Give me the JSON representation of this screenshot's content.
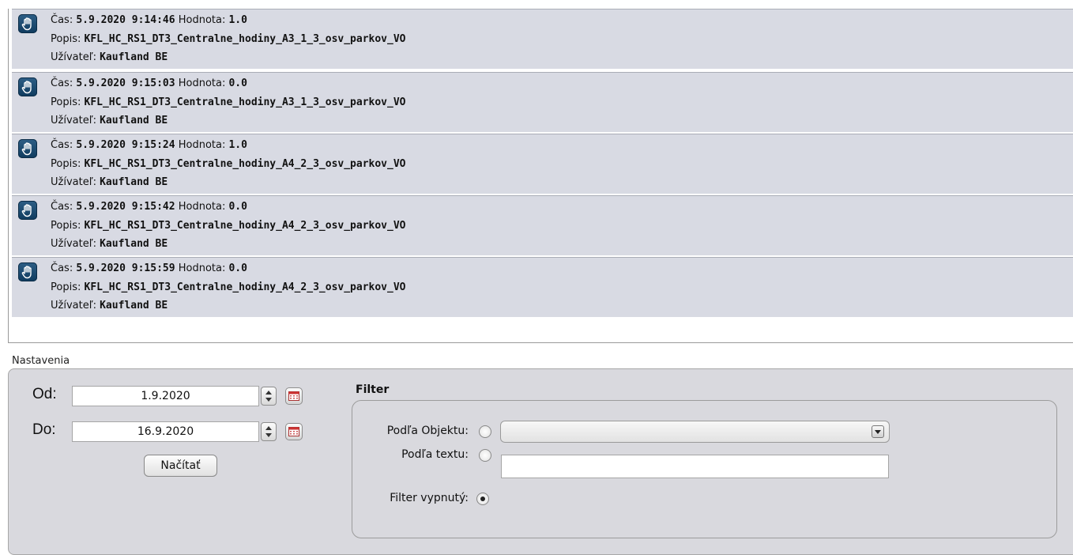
{
  "log": {
    "labels": {
      "cas": "Čas:",
      "hodnota": "Hodnota:",
      "popis": "Popis:",
      "uzivatel": "Užívateľ:"
    },
    "entries": [
      {
        "time": "5.9.2020 9:14:46",
        "value": "1.0",
        "description": "KFL_HC_RS1_DT3_Centralne_hodiny_A3_1_3_osv_parkov_VO",
        "user": "Kaufland BE"
      },
      {
        "time": "5.9.2020 9:15:03",
        "value": "0.0",
        "description": "KFL_HC_RS1_DT3_Centralne_hodiny_A3_1_3_osv_parkov_VO",
        "user": "Kaufland BE"
      },
      {
        "time": "5.9.2020 9:15:24",
        "value": "1.0",
        "description": "KFL_HC_RS1_DT3_Centralne_hodiny_A4_2_3_osv_parkov_VO",
        "user": "Kaufland BE"
      },
      {
        "time": "5.9.2020 9:15:42",
        "value": "0.0",
        "description": "KFL_HC_RS1_DT3_Centralne_hodiny_A4_2_3_osv_parkov_VO",
        "user": "Kaufland BE"
      },
      {
        "time": "5.9.2020 9:15:59",
        "value": "0.0",
        "description": "KFL_HC_RS1_DT3_Centralne_hodiny_A4_2_3_osv_parkov_VO",
        "user": "Kaufland BE"
      }
    ],
    "icon": "hand-stop-icon"
  },
  "settings": {
    "title": "Nastavenia",
    "from_label": "Od:",
    "from_date": "1.9.2020",
    "to_label": "Do:",
    "to_date": "16.9.2020",
    "load_button": "Načítať"
  },
  "filter": {
    "title": "Filter",
    "by_object_label": "Podľa Objektu:",
    "by_object_selected": false,
    "object_select_value": "",
    "by_text_label": "Podľa textu:",
    "by_text_selected": false,
    "text_value": "",
    "off_label": "Filter vypnutý:",
    "off_selected": true
  },
  "colors": {
    "entry_bg": "#d8dae3",
    "panel_bg": "#d9d9de",
    "icon_bg": "#1f4d73"
  }
}
